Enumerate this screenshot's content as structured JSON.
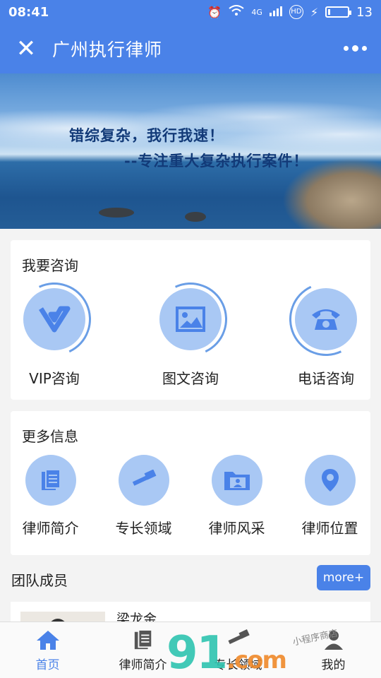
{
  "status_bar": {
    "time": "08:41",
    "network": "4G",
    "hd": "HD",
    "battery_level": "13",
    "battery_fill_fraction": 0.13
  },
  "title_bar": {
    "title": "广州执行律师",
    "close_icon": "close-icon",
    "menu_icon": "more-dots-icon"
  },
  "banner": {
    "line1": "错综复杂，我行我速！",
    "line2": "--专注重大复杂执行案件！"
  },
  "consult": {
    "heading": "我要咨询",
    "items": [
      {
        "label": "VIP咨询",
        "icon": "vip-icon"
      },
      {
        "label": "图文咨询",
        "icon": "image-icon"
      },
      {
        "label": "电话咨询",
        "icon": "phone-icon"
      }
    ]
  },
  "more_info": {
    "heading": "更多信息",
    "items": [
      {
        "label": "律师简介",
        "icon": "document-icon"
      },
      {
        "label": "专长领域",
        "icon": "gavel-icon"
      },
      {
        "label": "律师风采",
        "icon": "folder-person-icon"
      },
      {
        "label": "律师位置",
        "icon": "location-pin-icon"
      }
    ]
  },
  "team": {
    "title": "团队成员",
    "more_label": "more+",
    "member_name": "梁龙金"
  },
  "tabbar": {
    "tabs": [
      {
        "label": "首页",
        "icon": "home-icon",
        "active": true
      },
      {
        "label": "律师简介",
        "icon": "document-icon",
        "active": false
      },
      {
        "label": "专长领域",
        "icon": "gavel-icon",
        "active": false
      },
      {
        "label": "我的",
        "icon": "user-icon",
        "active": false
      }
    ]
  },
  "watermark": {
    "main": "91",
    "suffix": ".com",
    "small": "小程序商店"
  },
  "colors": {
    "primary": "#4a82e8",
    "icon_bg": "#a9c8f4",
    "page_bg": "#f3f3f3"
  }
}
